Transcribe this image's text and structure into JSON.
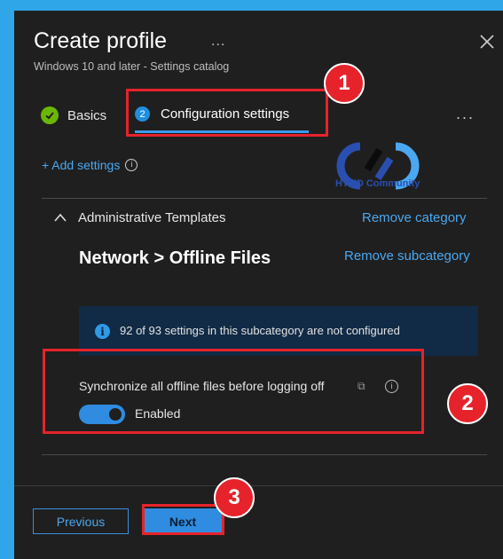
{
  "header": {
    "title": "Create profile",
    "title_more": "...",
    "subtitle": "Windows 10 and later - Settings catalog"
  },
  "tabs": [
    {
      "label": "Basics",
      "status": "complete"
    },
    {
      "label": "Configuration settings",
      "step": "2",
      "status": "active"
    }
  ],
  "more_menu": "...",
  "add_settings": {
    "label": "+ Add settings",
    "info": "i"
  },
  "watermark": {
    "text": "HTMD Community",
    "logo": "CHD"
  },
  "category": {
    "label": "Administrative Templates",
    "remove_label": "Remove category",
    "subcategory": "Network > Offline Files",
    "remove_sub_label": "Remove subcategory"
  },
  "info_banner": {
    "icon": "i",
    "text": "92 of 93 settings in this subcategory are not configured"
  },
  "setting": {
    "label": "Synchronize all offline files before logging off",
    "linked_icon": "⧉",
    "info": "i",
    "toggle_label": "Enabled",
    "enabled": true
  },
  "footer": {
    "previous_label": "Previous",
    "next_label": "Next"
  },
  "annotations": {
    "badge1": "1",
    "badge2": "2",
    "badge3": "3"
  },
  "colors": {
    "accent": "#2f8ce0",
    "link": "#4aa8f0",
    "highlight": "#e6232b",
    "background": "#2ea6e8",
    "panel": "#1f1f1f",
    "check": "#6bb700"
  }
}
